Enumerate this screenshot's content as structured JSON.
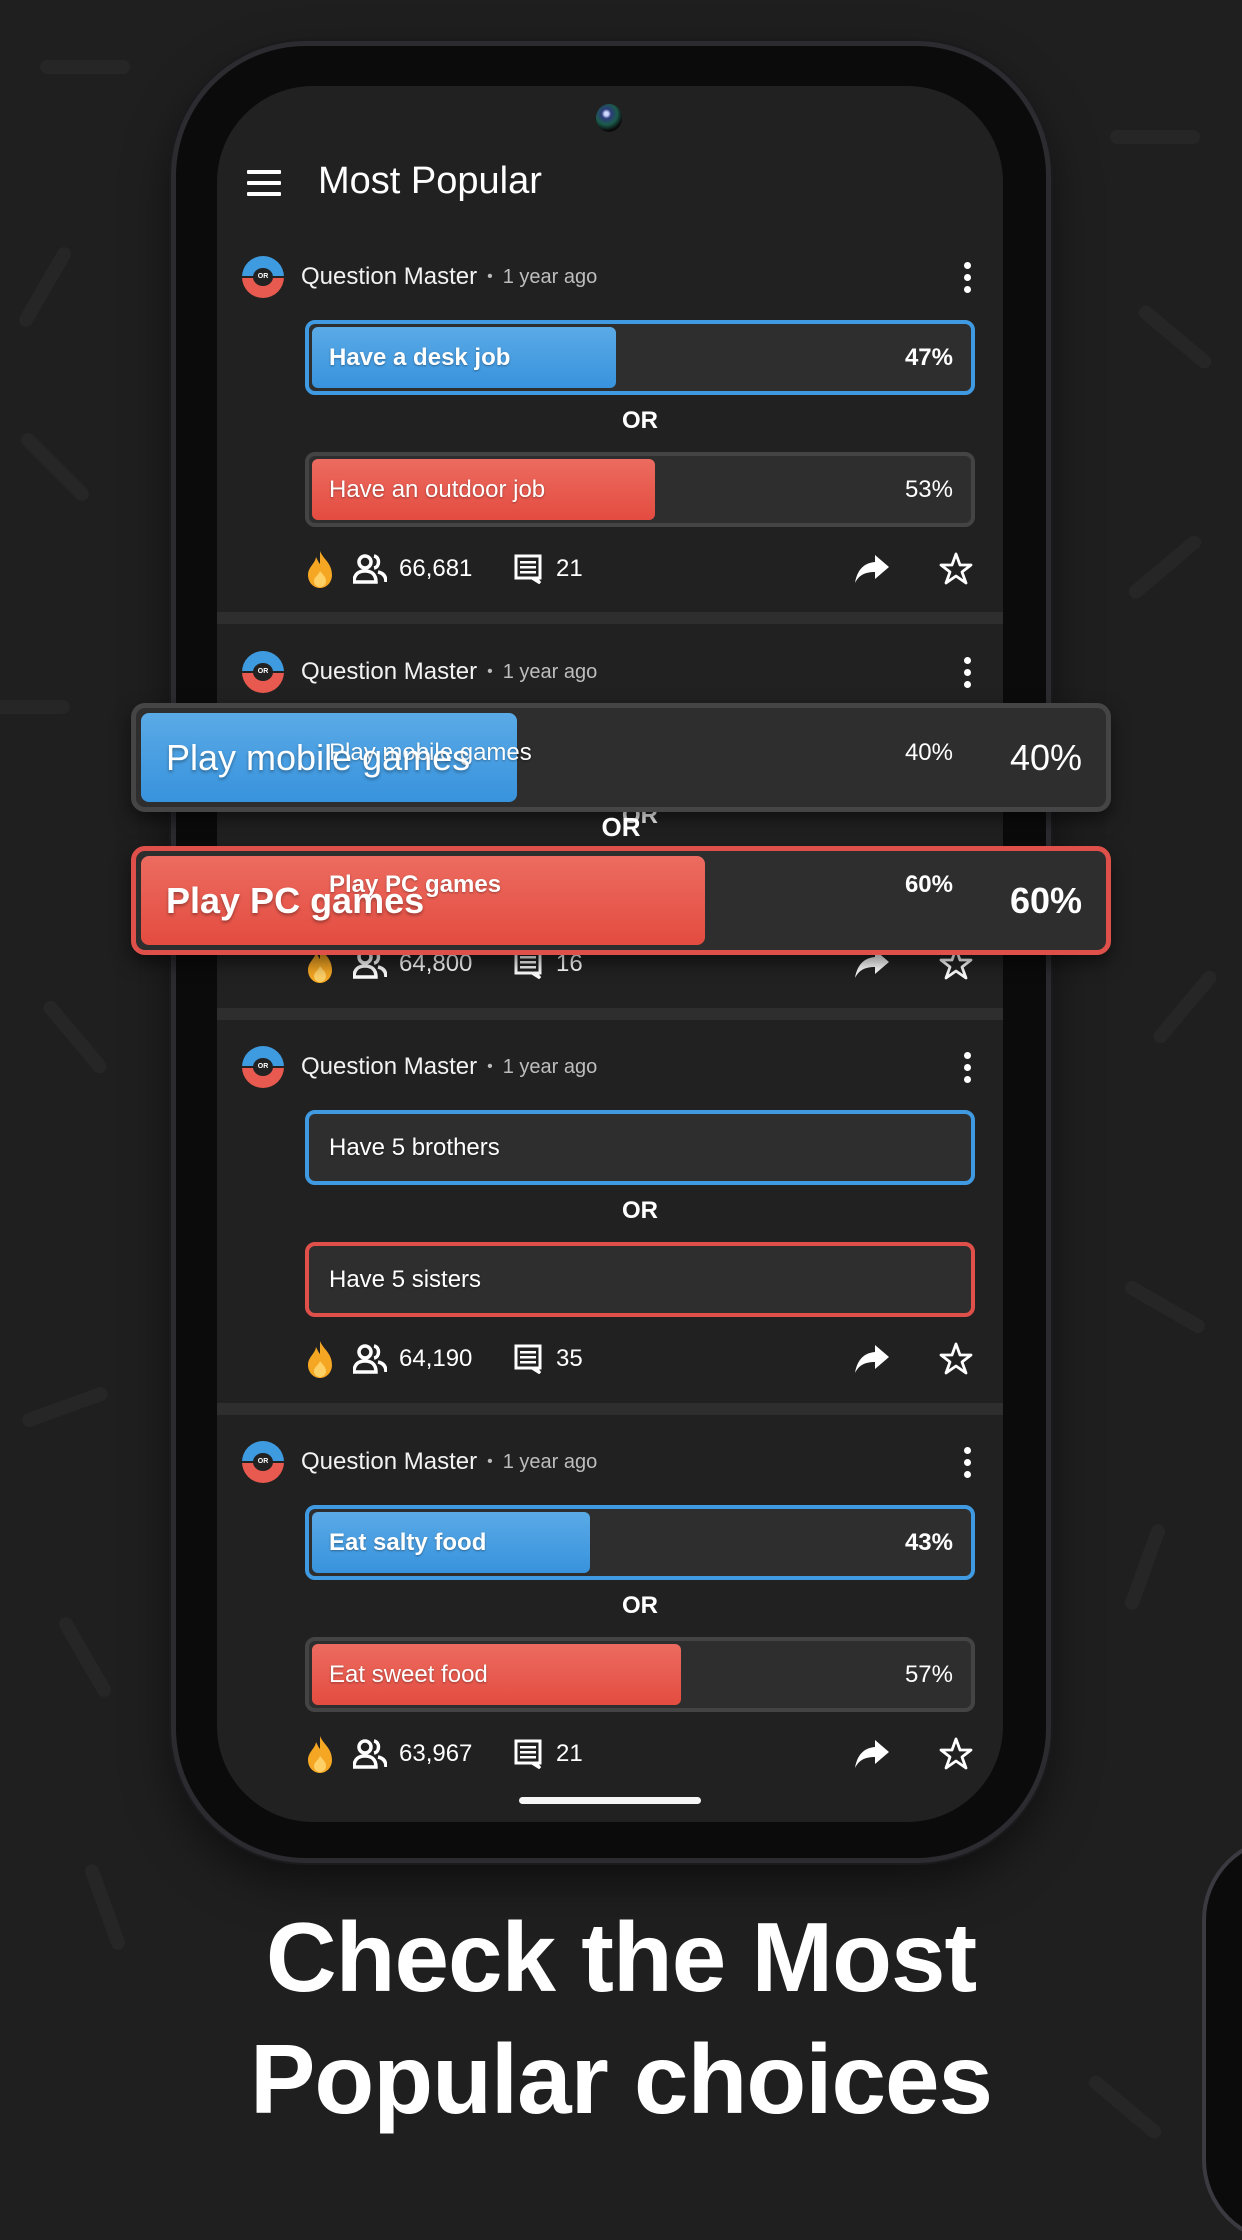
{
  "app": {
    "title": "Most Popular",
    "menu_icon": "hamburger-menu-icon"
  },
  "colors": {
    "blue": "#3f9ae2",
    "red": "#e0504a",
    "background": "#1f1f1f",
    "screen": "#212121",
    "fire": "#f5a623"
  },
  "questions": [
    {
      "author": "Question Master",
      "separator": "•",
      "time": "1 year ago",
      "option_a": {
        "label": "Have a desk job",
        "percent": 47,
        "percent_label": "47%",
        "selected": true
      },
      "or_label": "OR",
      "option_b": {
        "label": "Have an outdoor job",
        "percent": 53,
        "percent_label": "53%",
        "selected": false
      },
      "votes": "66,681",
      "comments": "21"
    },
    {
      "author": "Question Master",
      "separator": "•",
      "time": "1 year ago",
      "option_a": {
        "label": "Play mobile games",
        "percent": 40,
        "percent_label": "40%",
        "selected": false
      },
      "or_label": "OR",
      "option_b": {
        "label": "Play PC games",
        "percent": 60,
        "percent_label": "60%",
        "selected": true
      },
      "votes": "64,800",
      "comments": "16"
    },
    {
      "author": "Question Master",
      "separator": "•",
      "time": "1 year ago",
      "option_a": {
        "label": "Have 5 brothers",
        "selected": false
      },
      "or_label": "OR",
      "option_b": {
        "label": "Have 5 sisters",
        "selected": false
      },
      "votes": "64,190",
      "comments": "35"
    },
    {
      "author": "Question Master",
      "separator": "•",
      "time": "1 year ago",
      "option_a": {
        "label": "Eat salty food",
        "percent": 43,
        "percent_label": "43%",
        "selected": true
      },
      "or_label": "OR",
      "option_b": {
        "label": "Eat sweet food",
        "percent": 57,
        "percent_label": "57%",
        "selected": false
      },
      "votes": "63,967",
      "comments": "21"
    }
  ],
  "promo": {
    "headline_line1": "Check the Most",
    "headline_line2": "Popular choices"
  }
}
